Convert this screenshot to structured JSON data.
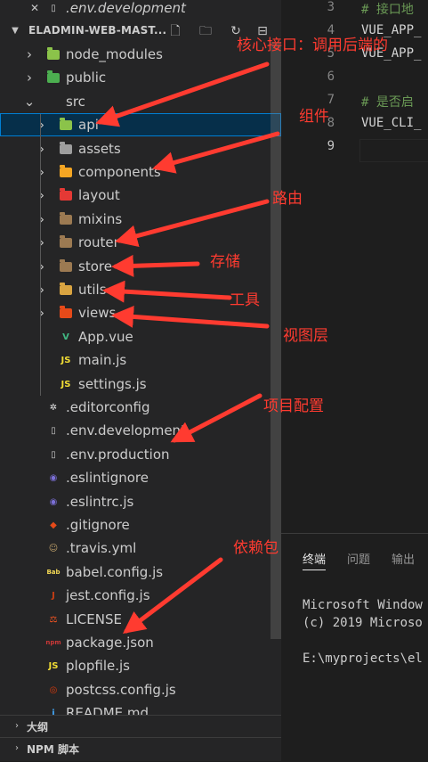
{
  "explorer": {
    "top_file": ".env.development",
    "project_title": "ELADMIN-WEB-MAST...",
    "header_icons": [
      "new-file-icon",
      "new-folder-icon",
      "refresh-icon",
      "collapse-all-icon"
    ],
    "items": [
      {
        "label": "node_modules",
        "level": 1,
        "kind": "folder",
        "icon": "node-folder-icon",
        "color": "#8bc34a"
      },
      {
        "label": "public",
        "level": 1,
        "kind": "folder",
        "icon": "public-folder-icon",
        "color": "#4caf50"
      },
      {
        "label": "src",
        "level": 1,
        "kind": "folder-open",
        "icon": "",
        "color": ""
      },
      {
        "label": "api",
        "level": 2,
        "kind": "folder",
        "icon": "api-folder-icon",
        "color": "#8bc34a",
        "selected": true
      },
      {
        "label": "assets",
        "level": 2,
        "kind": "folder",
        "icon": "assets-folder-icon",
        "color": "#9e9e9e"
      },
      {
        "label": "components",
        "level": 2,
        "kind": "folder",
        "icon": "components-folder-icon",
        "color": "#f5a623"
      },
      {
        "label": "layout",
        "level": 2,
        "kind": "folder",
        "icon": "layout-folder-icon",
        "color": "#e53935"
      },
      {
        "label": "mixins",
        "level": 2,
        "kind": "folder",
        "icon": "folder-icon",
        "color": "#9c7a52"
      },
      {
        "label": "router",
        "level": 2,
        "kind": "folder",
        "icon": "folder-icon",
        "color": "#9c7a52"
      },
      {
        "label": "store",
        "level": 2,
        "kind": "folder",
        "icon": "folder-icon",
        "color": "#9c7a52"
      },
      {
        "label": "utils",
        "level": 2,
        "kind": "folder",
        "icon": "utils-folder-icon",
        "color": "#d9a441"
      },
      {
        "label": "views",
        "level": 2,
        "kind": "folder",
        "icon": "views-folder-icon",
        "color": "#e64a19"
      },
      {
        "label": "App.vue",
        "level": 2,
        "kind": "file",
        "icon": "vue-icon",
        "color": "#41b883",
        "glyph": "V"
      },
      {
        "label": "main.js",
        "level": 2,
        "kind": "file",
        "icon": "js-icon",
        "color": "#f1dd35",
        "glyph": "JS"
      },
      {
        "label": "settings.js",
        "level": 2,
        "kind": "file",
        "icon": "js-icon",
        "color": "#f1dd35",
        "glyph": "JS"
      },
      {
        "label": ".editorconfig",
        "level": 1,
        "kind": "file",
        "icon": "editorconfig-icon",
        "color": "#e8e8e8",
        "glyph": "✲"
      },
      {
        "label": ".env.development",
        "level": 1,
        "kind": "file",
        "icon": "file-icon",
        "color": "#cccccc",
        "glyph": "▯"
      },
      {
        "label": ".env.production",
        "level": 1,
        "kind": "file",
        "icon": "file-icon",
        "color": "#cccccc",
        "glyph": "▯"
      },
      {
        "label": ".eslintignore",
        "level": 1,
        "kind": "file",
        "icon": "eslint-icon",
        "color": "#7b6fd6",
        "glyph": "◉"
      },
      {
        "label": ".eslintrc.js",
        "level": 1,
        "kind": "file",
        "icon": "eslint-icon",
        "color": "#7b6fd6",
        "glyph": "◉"
      },
      {
        "label": ".gitignore",
        "level": 1,
        "kind": "file",
        "icon": "git-icon",
        "color": "#e64a19",
        "glyph": "◆"
      },
      {
        "label": ".travis.yml",
        "level": 1,
        "kind": "file",
        "icon": "travis-icon",
        "color": "#c2a36b",
        "glyph": "☺"
      },
      {
        "label": "babel.config.js",
        "level": 1,
        "kind": "file",
        "icon": "babel-icon",
        "color": "#f5da55",
        "glyph": "Bab"
      },
      {
        "label": "jest.config.js",
        "level": 1,
        "kind": "file",
        "icon": "jest-icon",
        "color": "#c63d14",
        "glyph": "J"
      },
      {
        "label": "LICENSE",
        "level": 1,
        "kind": "file",
        "icon": "license-icon",
        "color": "#ff5722",
        "glyph": "⚖"
      },
      {
        "label": "package.json",
        "level": 1,
        "kind": "file",
        "icon": "npm-icon",
        "color": "#cb3837",
        "glyph": "npm"
      },
      {
        "label": "plopfile.js",
        "level": 1,
        "kind": "file",
        "icon": "js-icon",
        "color": "#f1dd35",
        "glyph": "JS"
      },
      {
        "label": "postcss.config.js",
        "level": 1,
        "kind": "file",
        "icon": "postcss-icon",
        "color": "#dd3a0a",
        "glyph": "◎"
      },
      {
        "label": "README.md",
        "level": 1,
        "kind": "file",
        "icon": "markdown-icon",
        "color": "#42a5f5",
        "glyph": "i"
      }
    ],
    "sections": [
      {
        "label": "大纲"
      },
      {
        "label": "NPM 脚本"
      }
    ]
  },
  "editor": {
    "lines": [
      {
        "num": "3",
        "text": "# 接口地",
        "kind": "comment"
      },
      {
        "num": "4",
        "text": "VUE_APP_",
        "kind": "code"
      },
      {
        "num": "5",
        "text": "VUE_APP_",
        "kind": "code"
      },
      {
        "num": "6",
        "text": "",
        "kind": "code"
      },
      {
        "num": "7",
        "text": "# 是否启",
        "kind": "comment"
      },
      {
        "num": "8",
        "text": "VUE_CLI_",
        "kind": "code"
      },
      {
        "num": "9",
        "text": "",
        "kind": "code",
        "active": true
      }
    ]
  },
  "panel": {
    "tabs": [
      "终端",
      "问题",
      "输出"
    ],
    "terminal_lines": [
      "Microsoft Window",
      "(c) 2019 Microso",
      "",
      "E:\\myprojects\\el"
    ]
  },
  "annotations": [
    "核心接口：调用后端的",
    "组件",
    "路由",
    "存储",
    "工具",
    "视图层",
    "项目配置",
    "依赖包"
  ]
}
